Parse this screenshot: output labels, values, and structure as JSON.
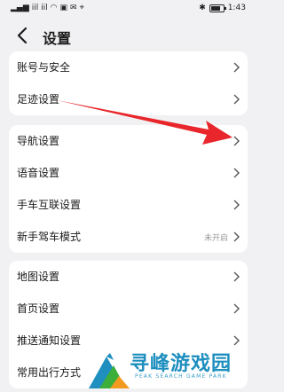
{
  "status_bar": {
    "left_text": "iil iil",
    "time": "1:43",
    "battery_level": 0.8,
    "icons": [
      "signal-icon",
      "wifi-icon",
      "chat-icon",
      "message-icon",
      "map-icon",
      "bluetooth-icon",
      "battery-icon"
    ]
  },
  "header": {
    "title": "设置",
    "back_icon": "chevron-left-icon"
  },
  "groups": [
    {
      "items": [
        {
          "label": "账号与安全"
        },
        {
          "label": "足迹设置"
        }
      ]
    },
    {
      "items": [
        {
          "label": "导航设置"
        },
        {
          "label": "语音设置"
        },
        {
          "label": "手车互联设置"
        },
        {
          "label": "新手驾车模式",
          "status": "未开启"
        }
      ]
    },
    {
      "items": [
        {
          "label": "地图设置"
        },
        {
          "label": "首页设置"
        },
        {
          "label": "推送通知设置"
        },
        {
          "label": "常用出行方式"
        }
      ]
    }
  ],
  "annotation": {
    "arrow_color": "#e8262b"
  },
  "watermark": {
    "title": "寻峰游戏园",
    "subtitle": "PEAK SEARCH GAME PARK",
    "colors": {
      "primary": "#1f8fbf",
      "green": "#3cae3a",
      "orange": "#f29a1f"
    }
  }
}
